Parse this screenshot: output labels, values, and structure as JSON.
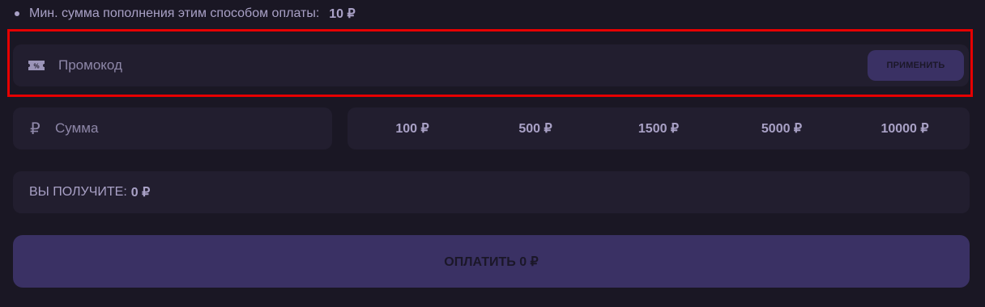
{
  "min_note": {
    "text": "Мин. сумма пополнения этим способом оплаты:",
    "value": "10 ₽"
  },
  "promo": {
    "placeholder": "Промокод",
    "value": "",
    "icon": "promo-ticket-icon",
    "apply_label": "ПРИМЕНИТЬ"
  },
  "amount": {
    "currency_symbol": "₽",
    "placeholder": "Сумма",
    "value": ""
  },
  "presets": [
    "100 ₽",
    "500 ₽",
    "1500 ₽",
    "5000 ₽",
    "10000 ₽"
  ],
  "receive": {
    "label": "ВЫ ПОЛУЧИТЕ:",
    "value": "0 ₽"
  },
  "pay_button": {
    "label": "ОПЛАТИТЬ 0 ₽"
  },
  "colors": {
    "background": "#1a1724",
    "panel": "#221e2f",
    "accent": "#3a3164",
    "highlight": "#e60000",
    "text": "#a9a1c6"
  }
}
